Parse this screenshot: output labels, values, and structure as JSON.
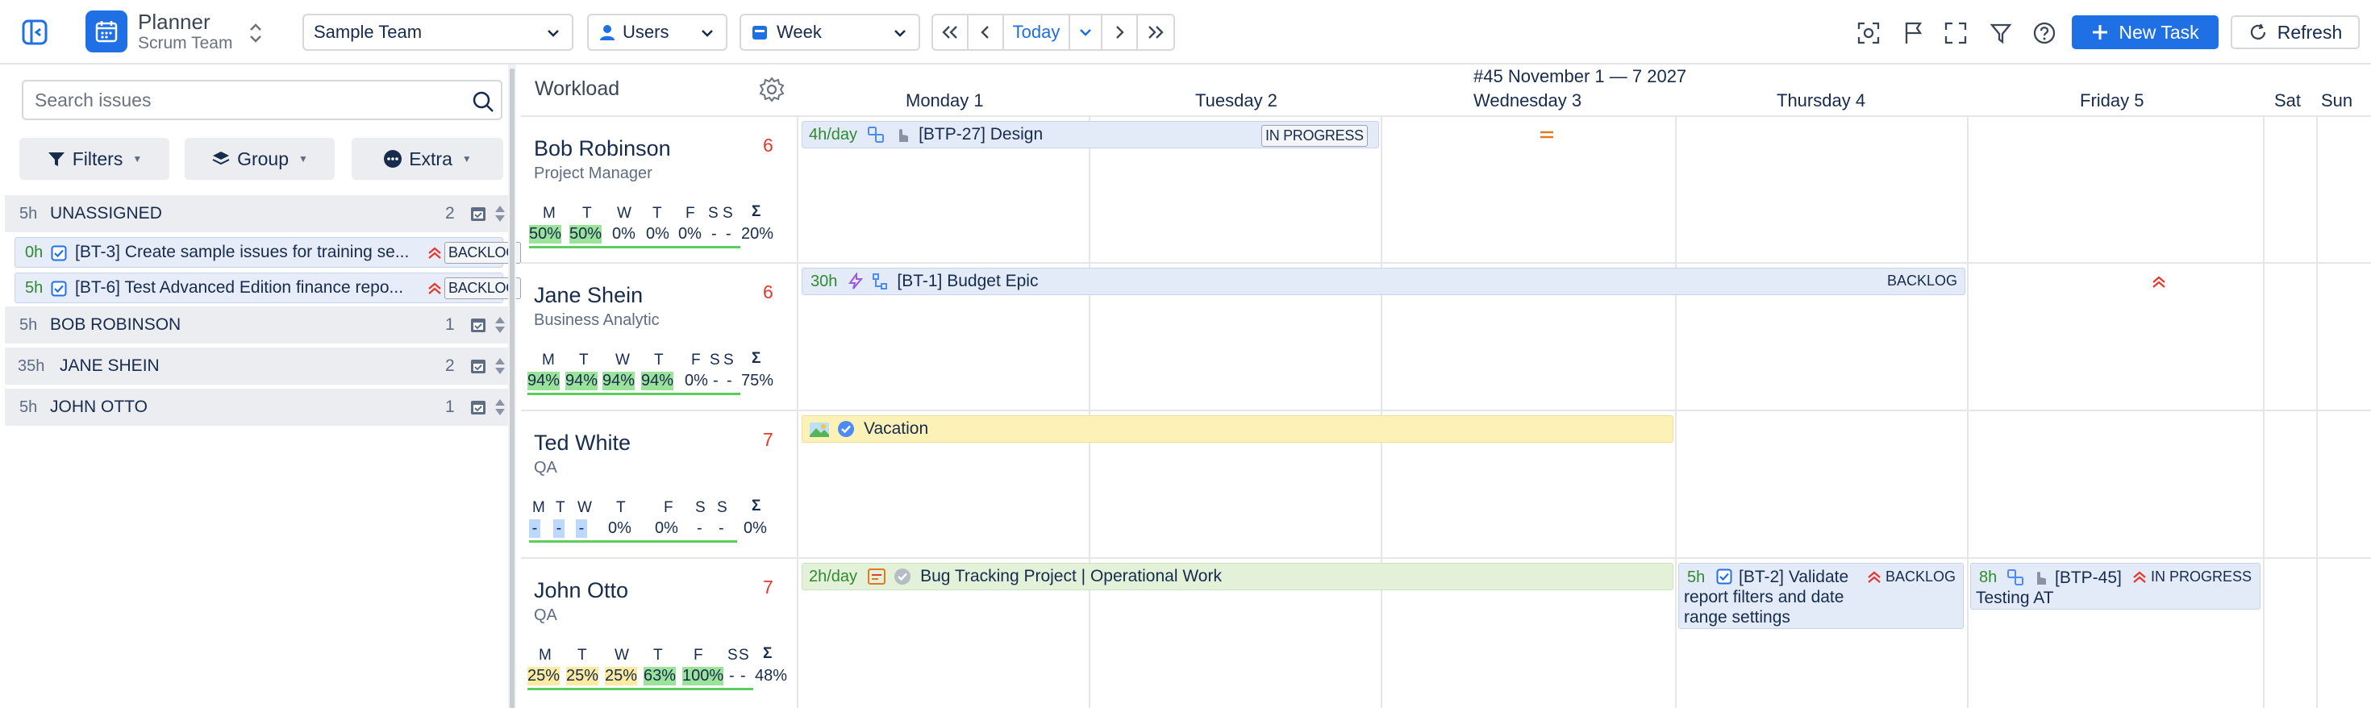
{
  "app": {
    "title": "Planner",
    "subtitle": "Scrum Team"
  },
  "toolbar": {
    "team": "Sample Team",
    "users": "Users",
    "view": "Week",
    "today": "Today",
    "new_task": "New Task",
    "refresh": "Refresh"
  },
  "sidebar": {
    "search_placeholder": "Search issues",
    "filters": "Filters",
    "group": "Group",
    "extra": "Extra",
    "groups": [
      {
        "hours": "5h",
        "name": "UNASSIGNED",
        "count": "2"
      },
      {
        "hours": "5h",
        "name": "BOB ROBINSON",
        "count": "1"
      },
      {
        "hours": "35h",
        "name": "JANE SHEIN",
        "count": "2"
      },
      {
        "hours": "5h",
        "name": "JOHN OTTO",
        "count": "1"
      }
    ],
    "issues": [
      {
        "hours": "0h",
        "title": "[BT-3] Create sample issues for training se...",
        "status": "BACKLOG"
      },
      {
        "hours": "5h",
        "title": "[BT-6] Test Advanced Edition finance repo...",
        "status": "BACKLOG"
      }
    ]
  },
  "calendar": {
    "title": "Workload",
    "week_range": "#45 November 1 — 7 2027",
    "days": [
      "Monday 1",
      "Tuesday 2",
      "Wednesday 3",
      "Thursday 4",
      "Friday 5",
      "Sat",
      "Sun"
    ],
    "sigma": "Σ",
    "people": [
      {
        "name": "Bob Robinson",
        "role": "Project Manager",
        "count": "6",
        "day_letters": [
          "M",
          "T",
          "W",
          "T",
          "F",
          "S",
          "S"
        ],
        "pcts": [
          "50%",
          "50%",
          "0%",
          "0%",
          "0%",
          "-",
          "-"
        ],
        "total": "20%"
      },
      {
        "name": "Jane Shein",
        "role": "Business Analytic",
        "count": "6",
        "day_letters": [
          "M",
          "T",
          "W",
          "T",
          "F",
          "S",
          "S"
        ],
        "pcts": [
          "94%",
          "94%",
          "94%",
          "94%",
          "0%",
          "-",
          "-"
        ],
        "total": "75%"
      },
      {
        "name": "Ted White",
        "role": "QA",
        "count": "7",
        "day_letters": [
          "M",
          "T",
          "W",
          "T",
          "F",
          "S",
          "S"
        ],
        "pcts": [
          "-",
          "-",
          "-",
          "0%",
          "0%",
          "-",
          "-"
        ],
        "total": "0%"
      },
      {
        "name": "John Otto",
        "role": "QA",
        "count": "7",
        "day_letters": [
          "M",
          "T",
          "W",
          "T",
          "F",
          "S",
          "S"
        ],
        "pcts": [
          "25%",
          "25%",
          "25%",
          "63%",
          "100%",
          "-",
          "-"
        ],
        "total": "48%"
      }
    ],
    "bars": {
      "design": {
        "rate": "4h/day",
        "title": "[BTP-27] Design",
        "status": "IN PROGRESS"
      },
      "budget": {
        "rate": "30h",
        "title": "[BT-1] Budget Epic",
        "status": "BACKLOG"
      },
      "vacation": {
        "title": "Vacation"
      },
      "bugtracking": {
        "rate": "2h/day",
        "title": "Bug Tracking Project | Operational Work"
      },
      "validate": {
        "rate": "5h",
        "title": "[BT-2] Validate report filters and date range settings",
        "status": "BACKLOG"
      },
      "testing": {
        "rate": "8h",
        "key": "[BTP-45]",
        "title": "Testing AT",
        "status": "IN PROGRESS"
      }
    }
  },
  "colors": {
    "accent": "#1f6fe5",
    "task_bar": "#e3ebf8",
    "vacation_bar": "#fcf2b8",
    "operational_bar": "#e3f1d9",
    "load_high": "#9be29b",
    "load_low": "#fbeaa0",
    "count_red": "#e5372b"
  }
}
